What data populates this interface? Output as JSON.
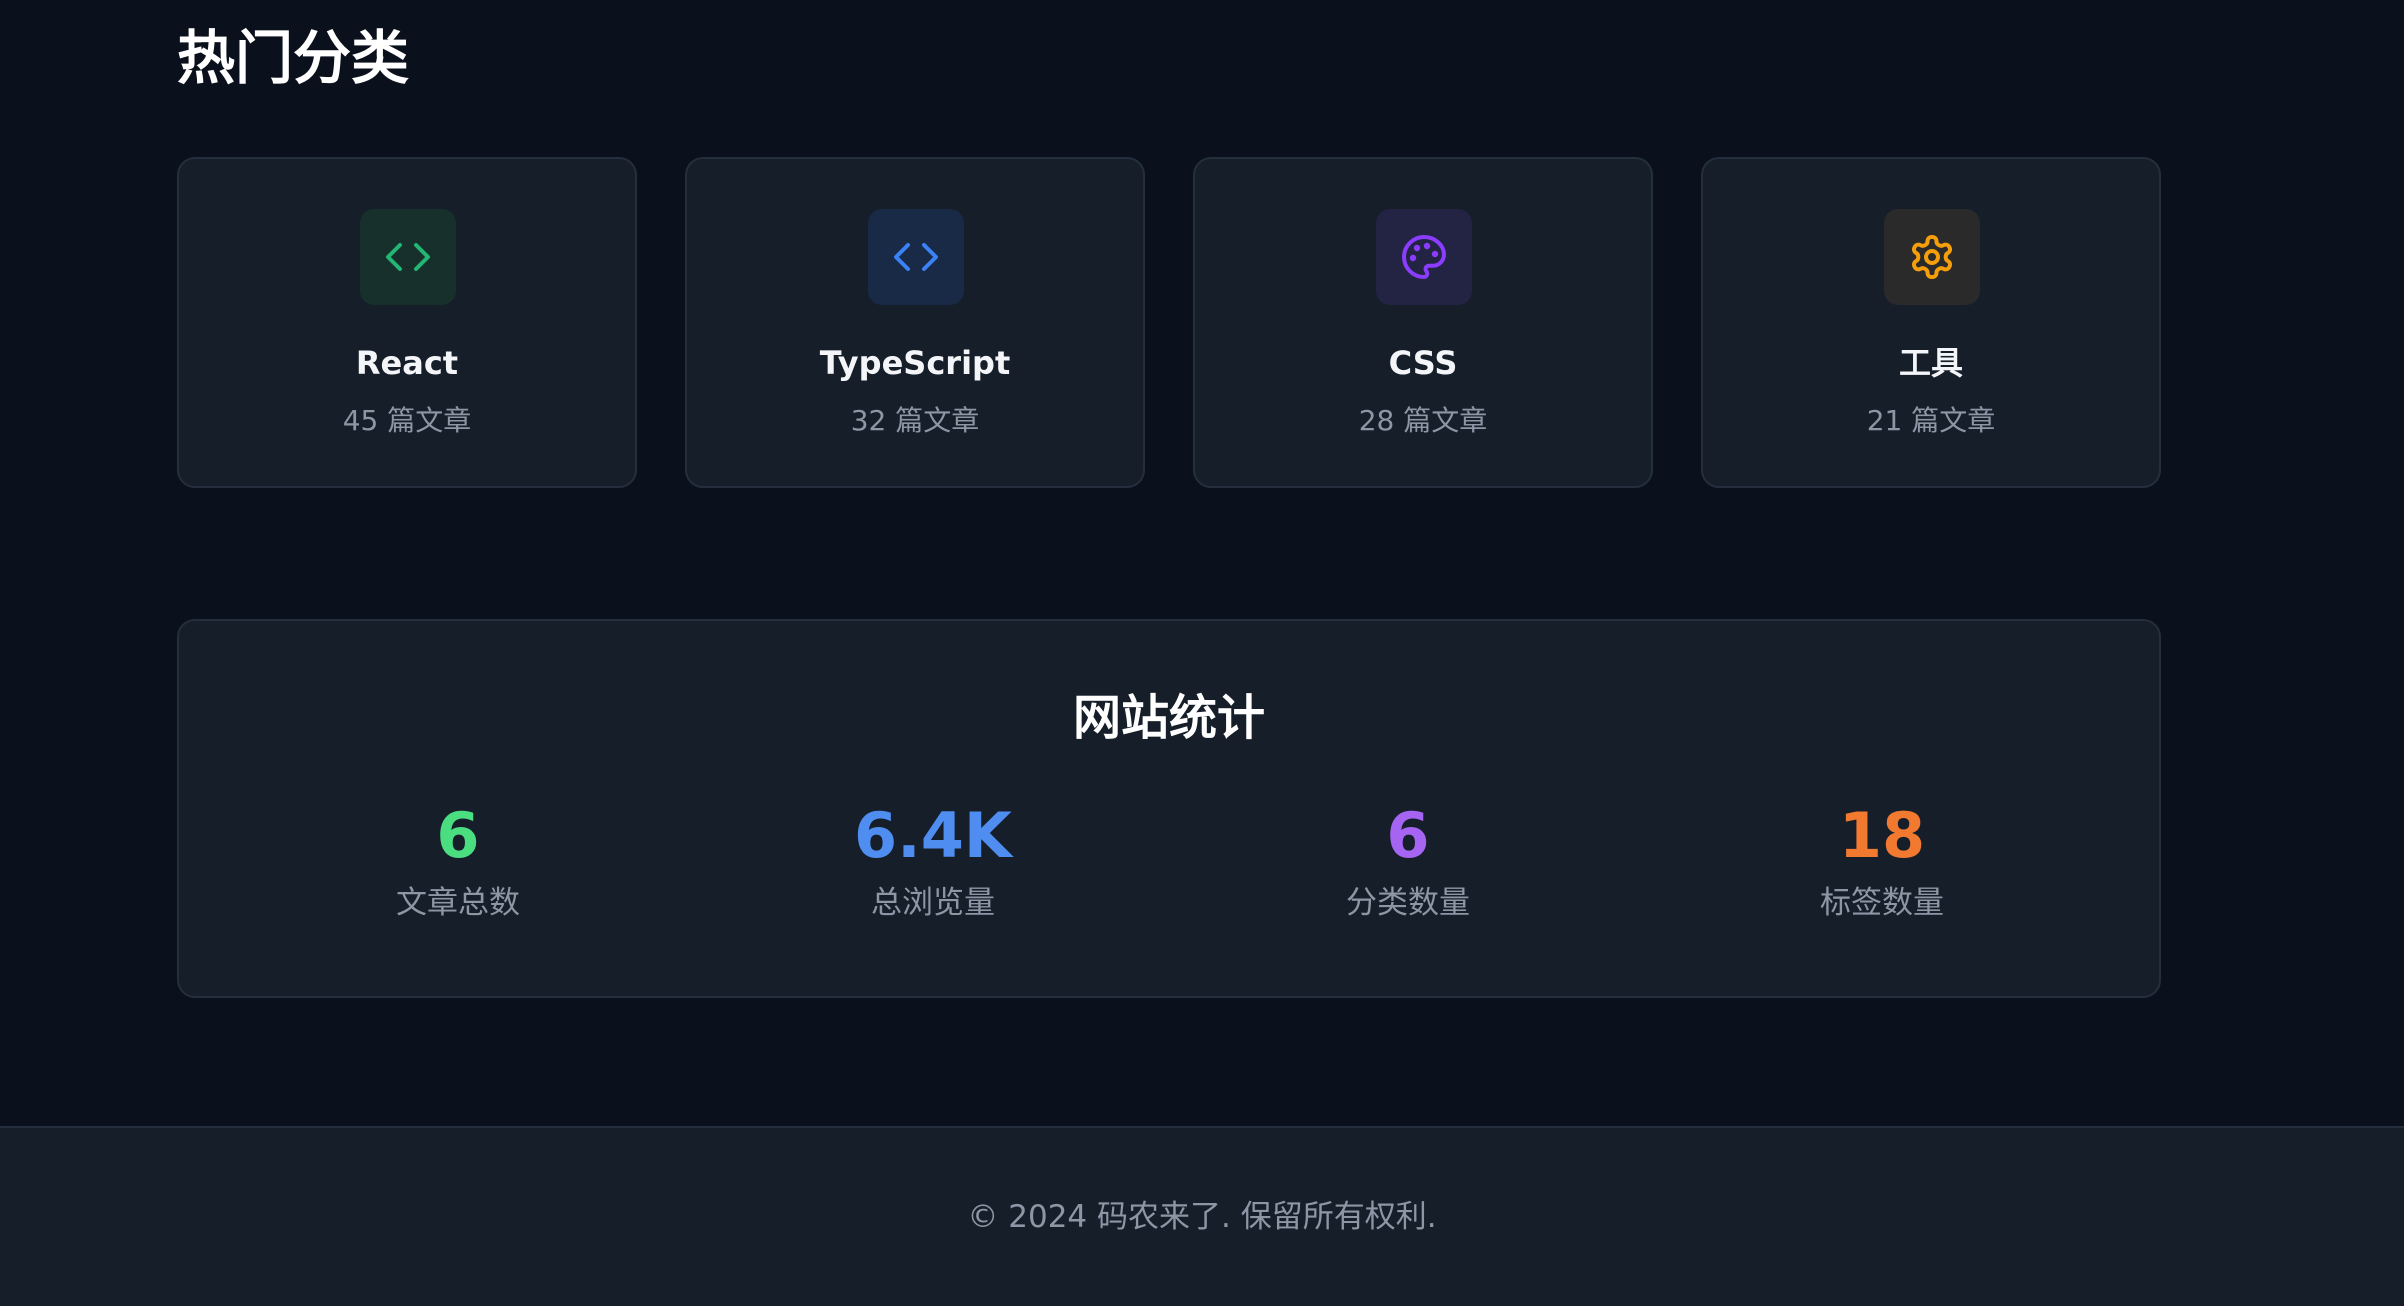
{
  "section": {
    "title": "热门分类"
  },
  "categories": [
    {
      "name": "React",
      "count": "45 篇文章",
      "icon": "code-icon",
      "icon_color": "#22b573",
      "icon_bg": "#17302c"
    },
    {
      "name": "TypeScript",
      "count": "32 篇文章",
      "icon": "code-icon",
      "icon_color": "#3b82f6",
      "icon_bg": "#192a47"
    },
    {
      "name": "CSS",
      "count": "28 篇文章",
      "icon": "palette-icon",
      "icon_color": "#8b3dff",
      "icon_bg": "#232443"
    },
    {
      "name": "工具",
      "count": "21 篇文章",
      "icon": "gear-icon",
      "icon_color": "#f59e0b",
      "icon_bg": "#2b2a2a"
    }
  ],
  "stats": {
    "title": "网站统计",
    "items": [
      {
        "value": "6",
        "label": "文章总数",
        "color": "#4ade80"
      },
      {
        "value": "6.4K",
        "label": "总浏览量",
        "color": "#4f8ef0"
      },
      {
        "value": "6",
        "label": "分类数量",
        "color": "#a565f2"
      },
      {
        "value": "18",
        "label": "标签数量",
        "color": "#f27a30"
      }
    ]
  },
  "footer": {
    "text": "© 2024 码农来了. 保留所有权利."
  }
}
